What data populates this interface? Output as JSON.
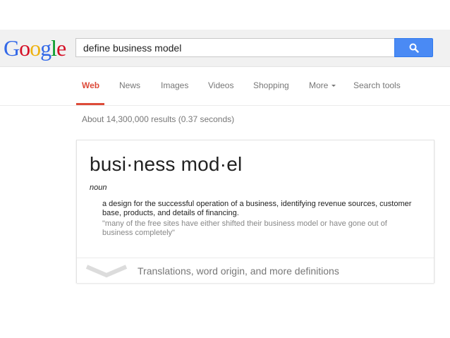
{
  "logo": {
    "letters": [
      "G",
      "o",
      "o",
      "g",
      "l",
      "e"
    ],
    "colors": [
      "#3369e8",
      "#d50f25",
      "#eeb211",
      "#3369e8",
      "#009925",
      "#d50f25"
    ]
  },
  "search": {
    "query": "define business model",
    "button_icon": "search-icon"
  },
  "nav": {
    "tabs": [
      {
        "label": "Web"
      },
      {
        "label": "News"
      },
      {
        "label": "Images"
      },
      {
        "label": "Videos"
      },
      {
        "label": "Shopping"
      },
      {
        "label": "More"
      },
      {
        "label": "Search tools"
      }
    ],
    "active_color": "#dd4b39"
  },
  "stats": "About 14,300,000 results (0.37 seconds)",
  "definition_card": {
    "headword": "busi·ness mod·el",
    "part_of_speech": "noun",
    "definition": "a design for the successful operation of a business, identifying revenue sources, customer base, products, and details of financing.",
    "example": "\"many of the free sites have either shifted their business model or have gone out of business completely\"",
    "more_link": "Translations, word origin, and more definitions",
    "more_icon": "chevron-down-icon"
  }
}
